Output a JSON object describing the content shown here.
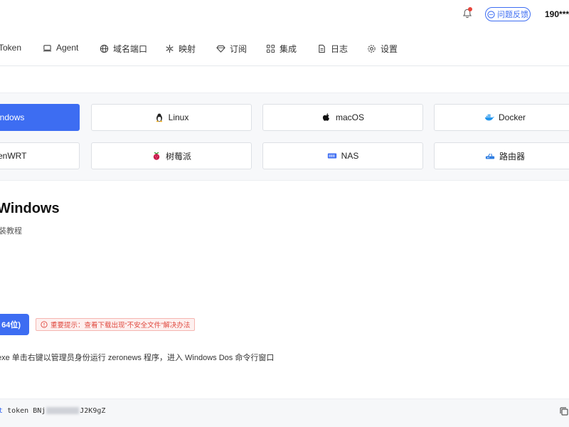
{
  "header": {
    "feedback_label": "问题反馈",
    "user_phone": "190***"
  },
  "nav": {
    "items": [
      {
        "label": "Token",
        "icon": "key-icon"
      },
      {
        "label": "Agent",
        "icon": "laptop-icon"
      },
      {
        "label": "域名端口",
        "icon": "globe-icon"
      },
      {
        "label": "映射",
        "icon": "snowflake-icon"
      },
      {
        "label": "订阅",
        "icon": "diamond-icon"
      },
      {
        "label": "集成",
        "icon": "apps-icon"
      },
      {
        "label": "日志",
        "icon": "document-icon"
      },
      {
        "label": "设置",
        "icon": "gear-icon"
      }
    ]
  },
  "os_tabs": [
    {
      "label": "indows",
      "icon": "windows-icon",
      "active": true
    },
    {
      "label": "Linux",
      "icon": "linux-penguin-icon"
    },
    {
      "label": "macOS",
      "icon": "apple-icon"
    },
    {
      "label": "Docker",
      "icon": "docker-whale-icon"
    },
    {
      "label": "enWRT",
      "icon": "openwrt-icon"
    },
    {
      "label": "树莓派",
      "icon": "raspberry-icon"
    },
    {
      "label": "NAS",
      "icon": "nas-icon"
    },
    {
      "label": "路由器",
      "icon": "router-icon"
    }
  ],
  "section": {
    "title": "Windows",
    "subtitle": "装教程"
  },
  "download": {
    "label": "64位)",
    "warning": "重要提示：查看下载出现“不安全文件”解决办法"
  },
  "instruction": "exe 单击右键以管理员身份运行 zeronews 程序，进入 Windows Dos 命令行窗口",
  "command": {
    "prefix": "t",
    "keyword": "token",
    "token_start": "BNj",
    "token_end": "J2K9gZ"
  },
  "colors": {
    "accent": "#3d6df2",
    "warning": "#e0483e",
    "notification_dot": "#e8443a"
  }
}
